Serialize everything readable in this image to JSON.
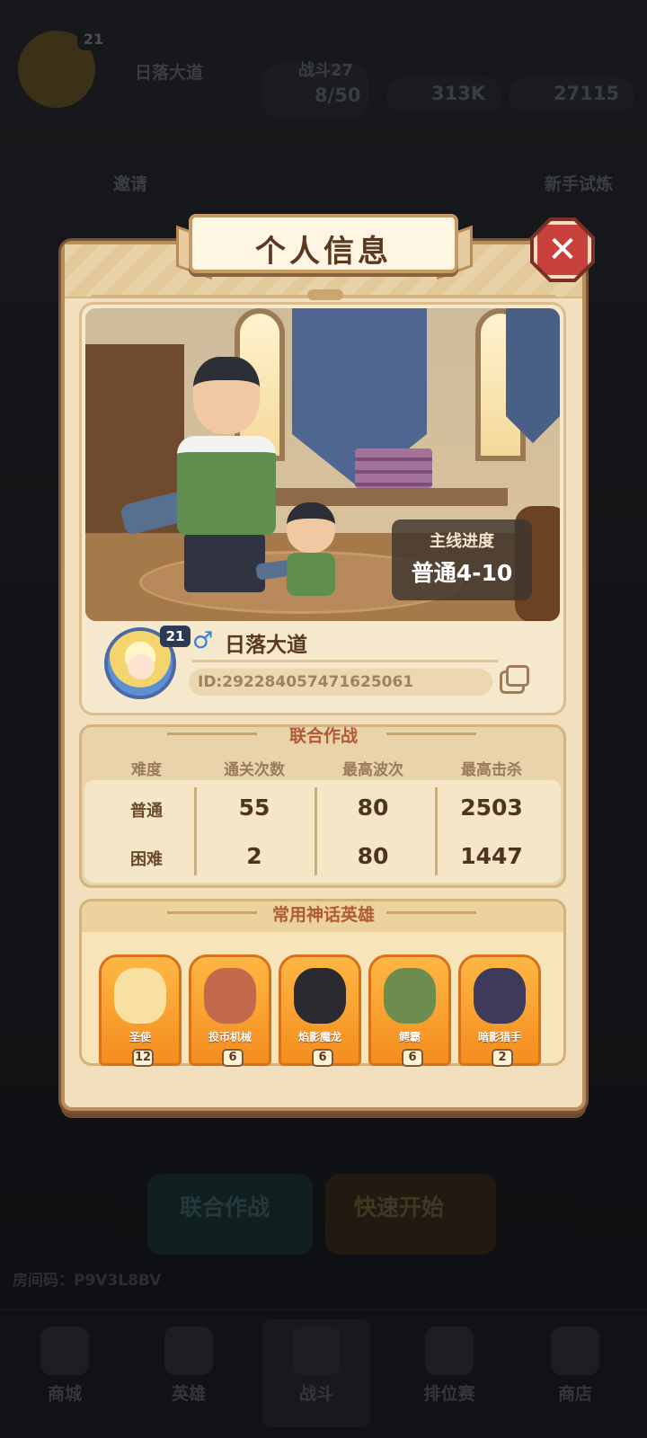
{
  "background": {
    "player_level": "21",
    "player_name": "日落大道",
    "stage_label": "战斗27",
    "energy": "8/50",
    "gold": "313K",
    "gems": "27115",
    "side_labels": [
      "邀请",
      "新手试炼"
    ],
    "bottom_tabs": [
      "商城",
      "英雄",
      "战斗",
      "排位赛",
      "商店"
    ],
    "buttons": [
      "联合作战",
      "快速开始"
    ],
    "room_code": "P9V3L8BV"
  },
  "dialog": {
    "title": "个人信息",
    "close_icon": "close-icon",
    "main_progress_label": "主线进度",
    "main_progress_value": "普通4-10",
    "player_level": "21",
    "gender_icon": "♂",
    "nickname": "日落大道",
    "id_text": "ID:292284057471625061"
  },
  "coop": {
    "title": "联合作战",
    "headers": [
      "难度",
      "通关次数",
      "最高波次",
      "最高击杀"
    ],
    "rows": [
      {
        "difficulty": "普通",
        "clears": "55",
        "max_wave": "80",
        "max_kills": "2503"
      },
      {
        "difficulty": "困难",
        "clears": "2",
        "max_wave": "80",
        "max_kills": "1447"
      }
    ]
  },
  "heroes": {
    "title": "常用神话英雄",
    "list": [
      {
        "name": "圣使",
        "level": "12",
        "color": "#f7e0a0"
      },
      {
        "name": "投币机械",
        "level": "6",
        "color": "#c46a4c"
      },
      {
        "name": "焰影魔龙",
        "level": "6",
        "color": "#2a2a30"
      },
      {
        "name": "鳄霸",
        "level": "6",
        "color": "#6d8d4f"
      },
      {
        "name": "暗影猎手",
        "level": "2",
        "color": "#3e3a5c"
      }
    ]
  }
}
